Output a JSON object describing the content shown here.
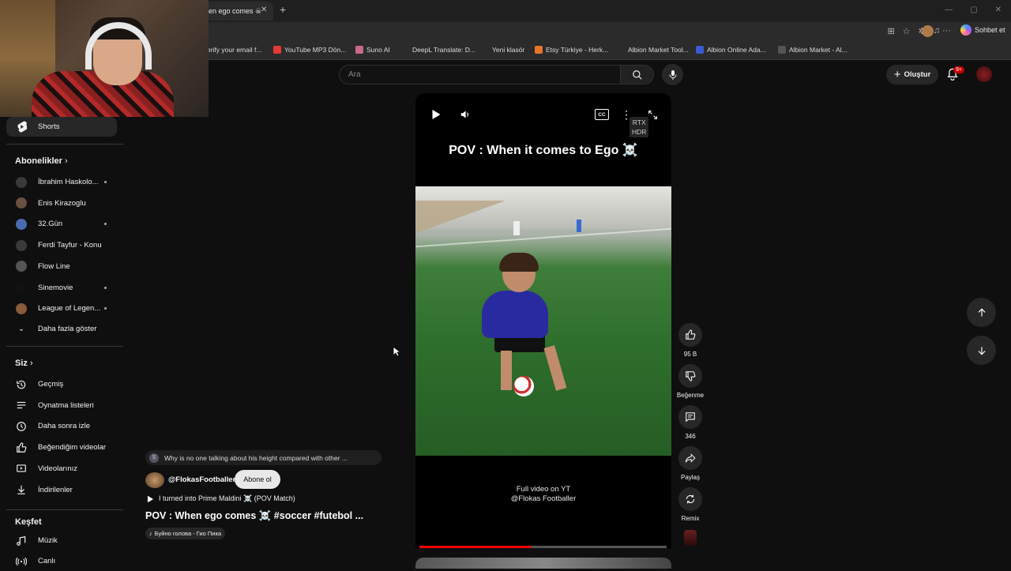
{
  "browser": {
    "tab_title": "en ego comes ☠",
    "tab_close": "✕",
    "new_tab": "+",
    "copilot_label": "Sohbet et",
    "bookmarks": [
      {
        "label": "erify your email f...",
        "color": "#4a4a4a"
      },
      {
        "label": "YouTube MP3 Dön...",
        "color": "#e53935"
      },
      {
        "label": "Suno AI",
        "color": "#c76a8a"
      },
      {
        "label": "DeepL Translate: D...",
        "color": "#2b2b2b"
      },
      {
        "label": "Yeni klasör",
        "color": "#2b2b2b"
      },
      {
        "label": "Etsy Türkiye - Herk...",
        "color": "#e8742a"
      },
      {
        "label": "Albion Market Tool...",
        "color": "#2b2b2b"
      },
      {
        "label": "Albion Online Ada...",
        "color": "#3a5ad0"
      },
      {
        "label": "Albion Market - Al...",
        "color": "#555"
      }
    ]
  },
  "masthead": {
    "search_placeholder": "Ara",
    "create_label": "Oluştur",
    "notif_count": "9+"
  },
  "sidebar": {
    "shorts_label": "Shorts",
    "subscriptions_header": "Abonelikler",
    "subscriptions": [
      {
        "label": "İbrahim Haskolo...",
        "color": "#3a3a3a",
        "dot": true
      },
      {
        "label": "Enis Kirazoglu",
        "color": "#6a5040",
        "dot": false
      },
      {
        "label": "32.Gün",
        "color": "#4a6ab0",
        "dot": true
      },
      {
        "label": "Ferdi Tayfur - Konu",
        "color": "#3a3a3a",
        "dot": false
      },
      {
        "label": "Flow Line",
        "color": "#555",
        "dot": false
      },
      {
        "label": "Sinemovie",
        "color": "#111",
        "dot": true
      },
      {
        "label": "League of Legen...",
        "color": "#8a5a3a",
        "dot": true
      }
    ],
    "show_more_label": "Daha fazla göster",
    "you_header": "Siz",
    "you_items": [
      {
        "label": "Geçmiş",
        "icon": "history-icon"
      },
      {
        "label": "Oynatma listeleri",
        "icon": "playlist-icon"
      },
      {
        "label": "Daha sonra izle",
        "icon": "clock-icon"
      },
      {
        "label": "Beğendiğim videolar",
        "icon": "thumbs-up-icon"
      },
      {
        "label": "Videolarınız",
        "icon": "your-videos-icon"
      },
      {
        "label": "İndirilenler",
        "icon": "download-icon"
      }
    ],
    "explore_header": "Keşfet",
    "explore_items": [
      {
        "label": "Müzik",
        "icon": "music-icon"
      },
      {
        "label": "Canlı",
        "icon": "live-icon"
      }
    ]
  },
  "player": {
    "title_overlay": "POV : When it comes to Ego ☠️",
    "rtx_line1": "RTX",
    "rtx_line2": "HDR",
    "caption_line1": "Full video on YT",
    "caption_line2": "@Flokas Footballer",
    "progress_fraction": 0.45
  },
  "actions": {
    "like_count": "95 B",
    "dislike_label": "Beğenme",
    "comment_count": "346",
    "share_label": "Paylaş",
    "remix_label": "Remix"
  },
  "description": {
    "comment_initial": "S",
    "comment_text": "Why is no one talking about his height compared with other ...",
    "channel_name": "@FlokasFootballer",
    "subscribe_label": "Abone ol",
    "related_video": "I turned into Prime Maldini ☠️ (POV Match)",
    "video_title": "POV : When ego comes ☠️ #soccer #futebol ...",
    "music": "Буйно голова - Гио Пика"
  }
}
